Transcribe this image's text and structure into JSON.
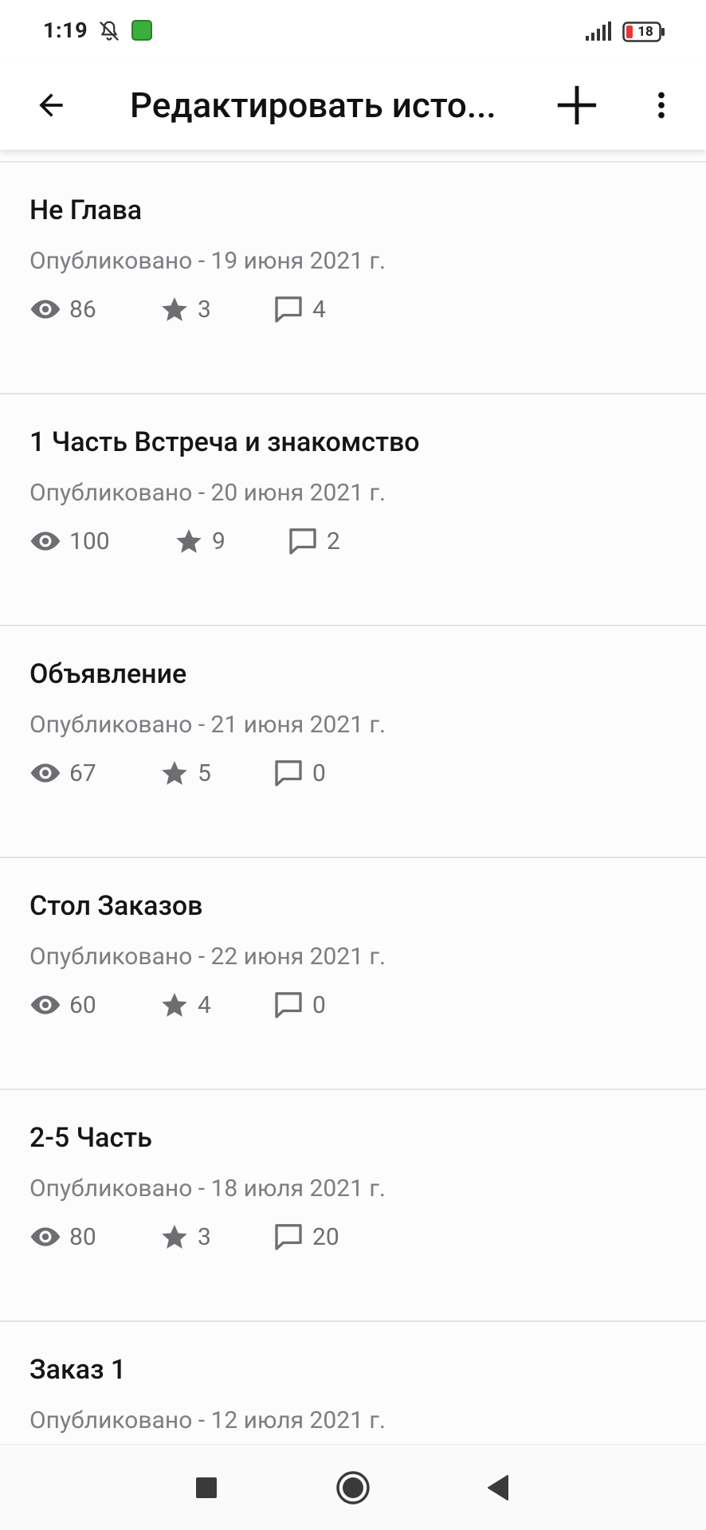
{
  "status_bar": {
    "time": "1:19",
    "battery": "18",
    "icons": [
      "bell-off-icon",
      "app-notification-icon",
      "signal-icon",
      "battery-icon"
    ]
  },
  "app_bar": {
    "title": "Редактировать исто...",
    "back_icon": "arrow-back-icon",
    "add_icon": "plus-icon",
    "more_icon": "more-vert-icon"
  },
  "parts": [
    {
      "title": "Не Глава",
      "meta": "Опубликовано - 19 июня 2021 г.",
      "views": "86",
      "votes": "3",
      "comments": "4"
    },
    {
      "title": "1 Часть Встреча и знакомство",
      "meta": "Опубликовано - 20 июня 2021 г.",
      "views": "100",
      "votes": "9",
      "comments": "2"
    },
    {
      "title": "Объявление",
      "meta": "Опубликовано - 21 июня 2021 г.",
      "views": "67",
      "votes": "5",
      "comments": "0"
    },
    {
      "title": "Стол Заказов",
      "meta": "Опубликовано - 22 июня 2021 г.",
      "views": "60",
      "votes": "4",
      "comments": "0"
    },
    {
      "title": "2-5 Часть",
      "meta": "Опубликовано - 18 июля 2021 г.",
      "views": "80",
      "votes": "3",
      "comments": "20"
    },
    {
      "title": "Заказ 1",
      "meta": "Опубликовано - 12 июля 2021 г.",
      "views": "",
      "votes": "",
      "comments": ""
    }
  ],
  "nav_bar": {
    "icons": [
      "recents-square-icon",
      "home-circle-icon",
      "back-triangle-icon"
    ]
  },
  "colors": {
    "background": "#fcfcfd",
    "text_primary": "#151515",
    "text_secondary": "#7d7d82",
    "icon_gray": "#6e6e72",
    "divider": "#e4e4e6"
  }
}
